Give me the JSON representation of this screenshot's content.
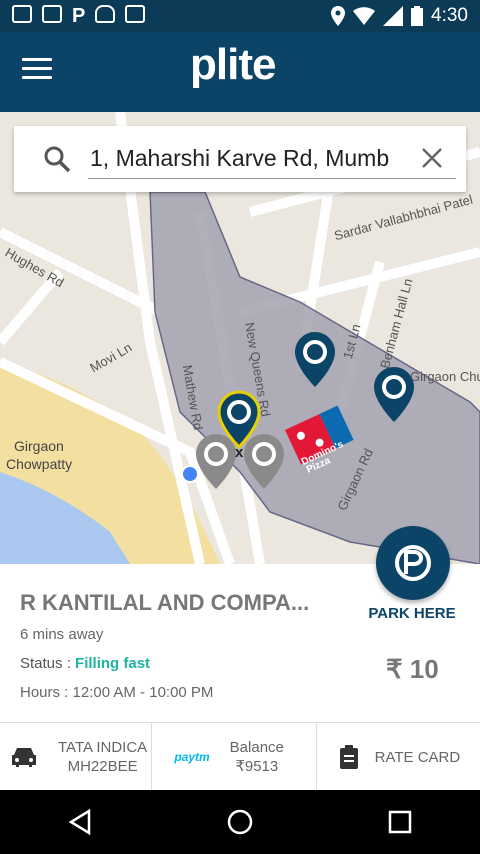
{
  "status_bar": {
    "time": "4:30",
    "icons": [
      "gmail-icon",
      "image-icon",
      "parking-icon",
      "android-icon",
      "briefcase-icon",
      "location-icon",
      "wifi-icon",
      "signal-icon",
      "battery-icon"
    ]
  },
  "app_bar": {
    "logo": "plite",
    "menu_icon": "menu-icon"
  },
  "search": {
    "value": "1, Maharshi Karve Rd, Mumb",
    "search_icon": "search-icon",
    "clear_icon": "close-icon"
  },
  "map": {
    "labels": {
      "sardar": "Sardar Vallabhbhai Patel",
      "hughes": "Hughes Rd",
      "movi": "Movi Ln",
      "mathew": "Mathew Rd",
      "new_queens": "New Queens Rd",
      "first_ln": "1st Ln",
      "benham": "Benham Hall Ln",
      "girgaon_chu": "Girgaon Chu",
      "girgaon_rd": "Girgaon Rd",
      "chowpatty_1": "Girgaon",
      "chowpatty_2": "Chowpatty",
      "dominos_1": "Domino's",
      "dominos_2": "Pizza",
      "marker_x": "x"
    }
  },
  "parking_info": {
    "name": "R KANTILAL AND COMPA...",
    "eta": "6 mins away",
    "status_label": "Status : ",
    "status_value": "Filling fast",
    "hours": "Hours : 12:00 AM - 10:00 PM",
    "price": "₹ 10",
    "park_here": "PARK HERE"
  },
  "bottom_bar": {
    "vehicle_name": "TATA INDICA",
    "vehicle_number": "MH22BEE",
    "wallet_brand": "paytm",
    "balance_label": "Balance",
    "balance_value": "₹9513",
    "rate_card": "RATE CARD"
  },
  "colors": {
    "primary": "#0b4466",
    "accent_green": "#1eb5a0",
    "zone_fill": "#a8a7b3"
  }
}
